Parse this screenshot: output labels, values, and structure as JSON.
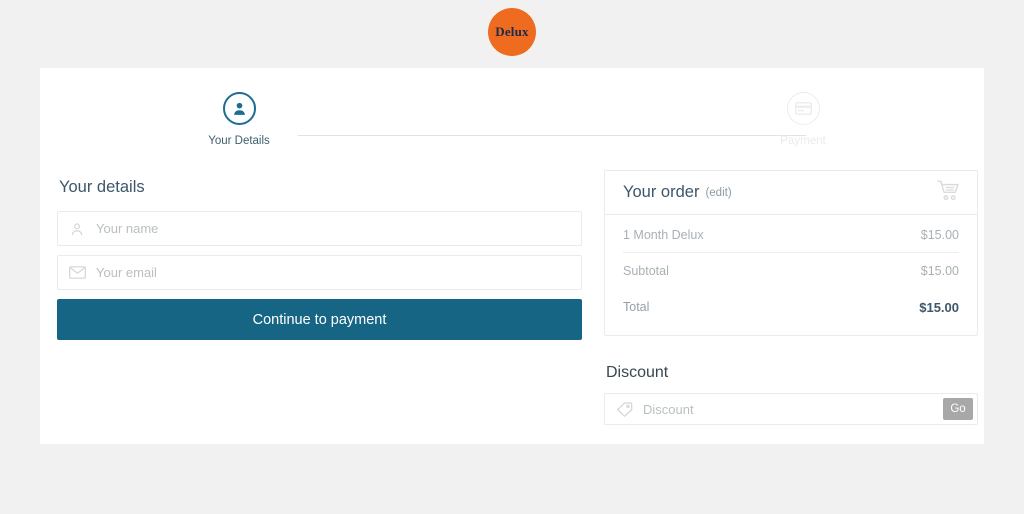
{
  "brand": {
    "logo_text": "Delux",
    "logo_color": "#ee6b1f",
    "logo_text_color": "#1d2a4a"
  },
  "steps": [
    {
      "label": "Your Details",
      "icon": "user-icon",
      "state": "active",
      "color": "#1c6d91"
    },
    {
      "label": "Payment",
      "icon": "credit-card-icon",
      "state": "inactive",
      "color": "#ebebeb"
    }
  ],
  "details": {
    "title": "Your details",
    "name_field": {
      "placeholder": "Your name",
      "value": "",
      "icon": "user-outline-icon"
    },
    "email_field": {
      "placeholder": "Your email",
      "value": "",
      "icon": "envelope-icon"
    },
    "submit_label": "Continue to payment",
    "submit_color": "#176585"
  },
  "order": {
    "title": "Your order",
    "edit_label": "(edit)",
    "cart_icon": "shopping-cart-icon",
    "items": [
      {
        "label": "1 Month Delux",
        "amount": "$15.00"
      }
    ],
    "subtotal": {
      "label": "Subtotal",
      "amount": "$15.00"
    },
    "total": {
      "label": "Total",
      "amount": "$15.00"
    }
  },
  "discount": {
    "title": "Discount",
    "field": {
      "placeholder": "Discount",
      "value": "",
      "icon": "tag-icon"
    },
    "go_label": "Go"
  }
}
